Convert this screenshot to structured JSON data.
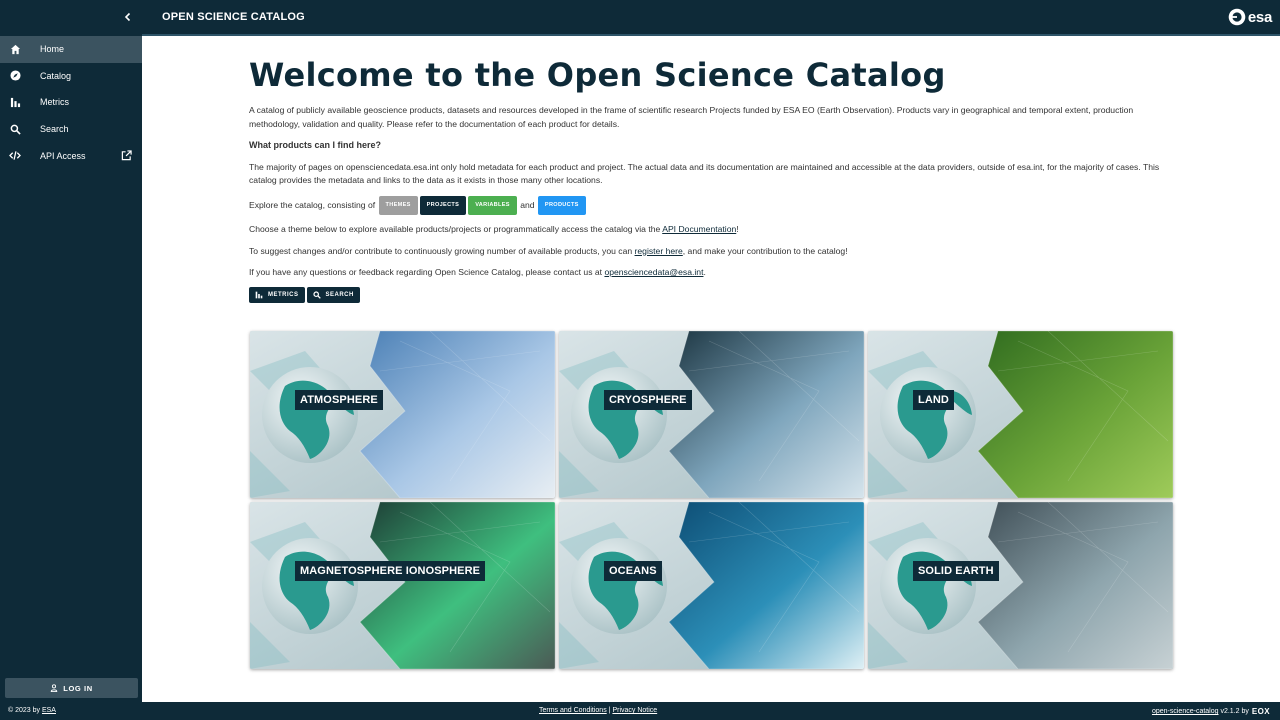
{
  "app": {
    "title": "OPEN SCIENCE CATALOG",
    "logo_text": "esa"
  },
  "sidebar": {
    "items": [
      {
        "label": "Home",
        "icon": "home-icon"
      },
      {
        "label": "Catalog",
        "icon": "compass-icon"
      },
      {
        "label": "Metrics",
        "icon": "bar-chart-icon"
      },
      {
        "label": "Search",
        "icon": "search-icon"
      },
      {
        "label": "API Access",
        "icon": "code-icon"
      }
    ],
    "login_label": "LOG IN"
  },
  "main": {
    "heading": "Welcome to the Open Science Catalog",
    "intro": "A catalog of publicly available geoscience products, datasets and resources developed in the frame of scientific research Projects funded by ESA EO (Earth Observation). Products vary in geographical and temporal extent, production methodology, validation and quality. Please refer to the documentation of each product for details.",
    "question": "What products can I find here?",
    "answer": "The majority of pages on opensciencedata.esa.int only hold metadata for each product and project. The actual data and its documentation are maintained and accessible at the data providers, outside of esa.int, for the majority of cases. This catalog provides the metadata and links to the data as it exists in those many other locations.",
    "explore_prefix": "Explore the catalog, consisting of",
    "explore_and": "and",
    "chips": [
      {
        "label": "THEMES",
        "color": "#9e9e9e"
      },
      {
        "label": "PROJECTS",
        "color": "#0e2a38"
      },
      {
        "label": "VARIABLES",
        "color": "#4caf50"
      },
      {
        "label": "PRODUCTS",
        "color": "#2196f3"
      }
    ],
    "choose_prefix": "Choose a theme below to explore available products/projects or programmatically access the catalog via the",
    "choose_link": "API Documentation",
    "choose_suffix": "!",
    "suggest_prefix": "To suggest changes and/or contribute to continuously growing number of available products, you can",
    "suggest_link": "register here",
    "suggest_suffix": ", and make your contribution to the catalog!",
    "contact_prefix": "If you have any questions or feedback regarding Open Science Catalog, please contact us at",
    "contact_link": "opensciencedata@esa.int",
    "contact_suffix": ".",
    "buttons": {
      "metrics": "METRICS",
      "search": "SEARCH"
    }
  },
  "themes": [
    {
      "label": "ATMOSPHERE",
      "colors": [
        "#4a7fb5",
        "#a9c7e6",
        "#e8eef3"
      ]
    },
    {
      "label": "CRYOSPHERE",
      "colors": [
        "#1b3440",
        "#7fa6bd",
        "#d6e4ec"
      ]
    },
    {
      "label": "LAND",
      "colors": [
        "#2f6b1f",
        "#6aa338",
        "#9fcb5a"
      ]
    },
    {
      "label": "MAGNETOSPHERE IONOSPHERE",
      "colors": [
        "#1d3b34",
        "#3fbf7f",
        "#4b5a55"
      ]
    },
    {
      "label": "OCEANS",
      "colors": [
        "#0d4c73",
        "#2c8fb8",
        "#dff0f5"
      ]
    },
    {
      "label": "SOLID EARTH",
      "colors": [
        "#3e4d55",
        "#8ea5ad",
        "#c7d1d4"
      ]
    }
  ],
  "footer": {
    "copyright": "© 2023 by",
    "copyright_link": "ESA",
    "terms": "Terms and Conditions",
    "separator": "|",
    "privacy": "Privacy Notice",
    "version_link": "open-science-catalog",
    "version": "v2.1.2 by",
    "eox": "EOX"
  }
}
